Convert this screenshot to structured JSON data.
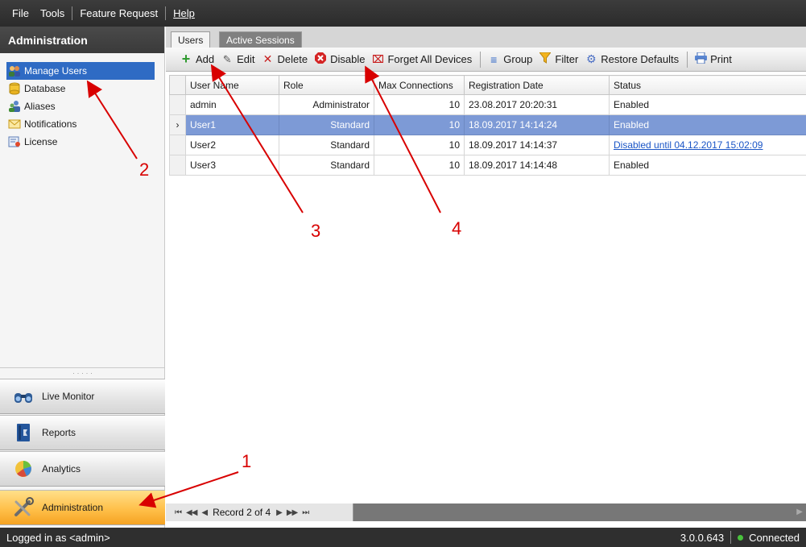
{
  "menu": {
    "items": [
      "File",
      "Tools",
      "Feature Request",
      "Help"
    ]
  },
  "sidebar": {
    "header": "Administration",
    "tree": [
      {
        "label": "Manage Users",
        "icon": "users-icon",
        "selected": true
      },
      {
        "label": "Database",
        "icon": "database-icon"
      },
      {
        "label": "Aliases",
        "icon": "aliases-icon"
      },
      {
        "label": "Notifications",
        "icon": "envelope-icon"
      },
      {
        "label": "License",
        "icon": "license-icon"
      }
    ],
    "nav_buttons": [
      {
        "label": "Live Monitor",
        "icon": "binoculars-icon"
      },
      {
        "label": "Reports",
        "icon": "reports-book-icon"
      },
      {
        "label": "Analytics",
        "icon": "pie-chart-icon"
      },
      {
        "label": "Administration",
        "icon": "tools-icon",
        "active": true
      }
    ]
  },
  "tabs": [
    {
      "label": "Users",
      "active": true
    },
    {
      "label": "Active Sessions"
    }
  ],
  "toolbar": {
    "add": "Add",
    "edit": "Edit",
    "delete": "Delete",
    "disable": "Disable",
    "forget_devices": "Forget All Devices",
    "group": "Group",
    "filter": "Filter",
    "restore_defaults": "Restore Defaults",
    "print": "Print"
  },
  "grid": {
    "columns": [
      "User Name",
      "Role",
      "Max Connections",
      "Registration Date",
      "Status"
    ],
    "rows": [
      {
        "user": "admin",
        "role": "Administrator",
        "max": "10",
        "date": "23.08.2017 20:20:31",
        "status": "Enabled"
      },
      {
        "user": "User1",
        "role": "Standard",
        "max": "10",
        "date": "18.09.2017 14:14:24",
        "status": "Enabled",
        "selected": true
      },
      {
        "user": "User2",
        "role": "Standard",
        "max": "10",
        "date": "18.09.2017 14:14:37",
        "status": "Disabled until 04.12.2017 15:02:09"
      },
      {
        "user": "User3",
        "role": "Standard",
        "max": "10",
        "date": "18.09.2017 14:14:48",
        "status": "Enabled"
      }
    ]
  },
  "navigator": {
    "record_text": "Record 2 of 4"
  },
  "status": {
    "logged_in": "Logged in as <admin>",
    "version": "3.0.0.643",
    "connection": "Connected"
  },
  "annotations": {
    "labels": [
      "1",
      "2",
      "3",
      "4"
    ]
  },
  "colors": {
    "selection": "#2f6bc4",
    "row_selected": "#7d9ad6",
    "annotation": "#d80000",
    "connected": "#49c23d",
    "active_nav": "#ffc04a"
  }
}
